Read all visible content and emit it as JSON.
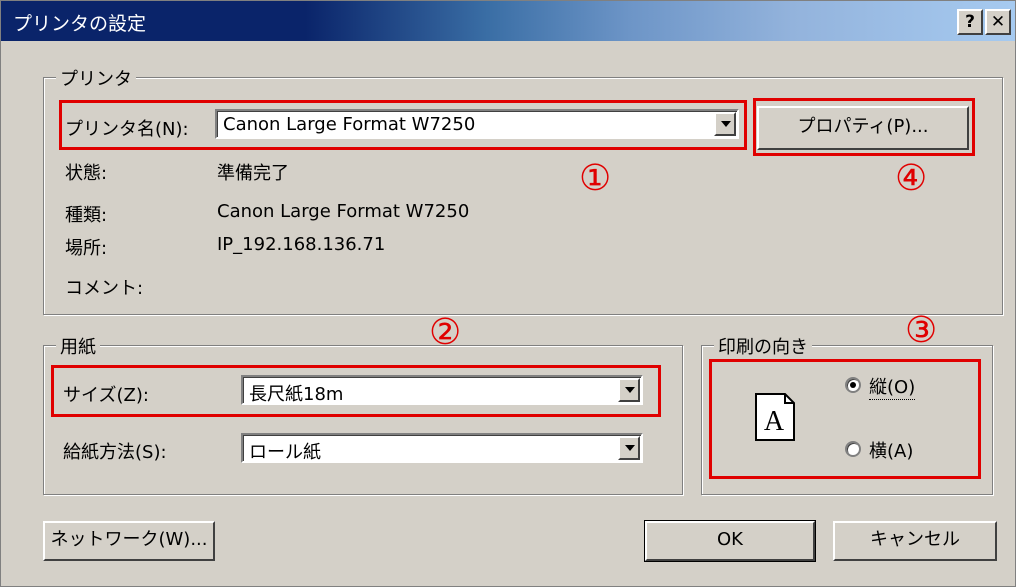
{
  "window": {
    "title": "プリンタの設定",
    "help_button": "?",
    "close_button": "✕"
  },
  "printer_group": {
    "legend": "プリンタ",
    "name_label": "プリンタ名(N):",
    "name_value": "Canon Large Format W7250",
    "properties_button": "プロパティ(P)...",
    "status_label": "状態:",
    "status_value": "準備完了",
    "type_label": "種類:",
    "type_value": "Canon Large Format W7250",
    "location_label": "場所:",
    "location_value": "IP_192.168.136.71",
    "comment_label": "コメント:"
  },
  "paper_group": {
    "legend": "用紙",
    "size_label": "サイズ(Z):",
    "size_value": "長尺紙18m",
    "source_label": "給紙方法(S):",
    "source_value": "ロール紙"
  },
  "orientation_group": {
    "legend": "印刷の向き",
    "icon_letter": "A",
    "portrait_label": "縦(O)",
    "landscape_label": "横(A)",
    "selected": "portrait"
  },
  "buttons": {
    "network": "ネットワーク(W)...",
    "ok": "OK",
    "cancel": "キャンセル"
  },
  "annotations": {
    "n1": "①",
    "n2": "②",
    "n3": "③",
    "n4": "④"
  },
  "colors": {
    "annotation_red": "#e00000",
    "titlebar_start": "#0a246a",
    "titlebar_end": "#a6caf0",
    "dialog_bg": "#d4d0c8"
  }
}
